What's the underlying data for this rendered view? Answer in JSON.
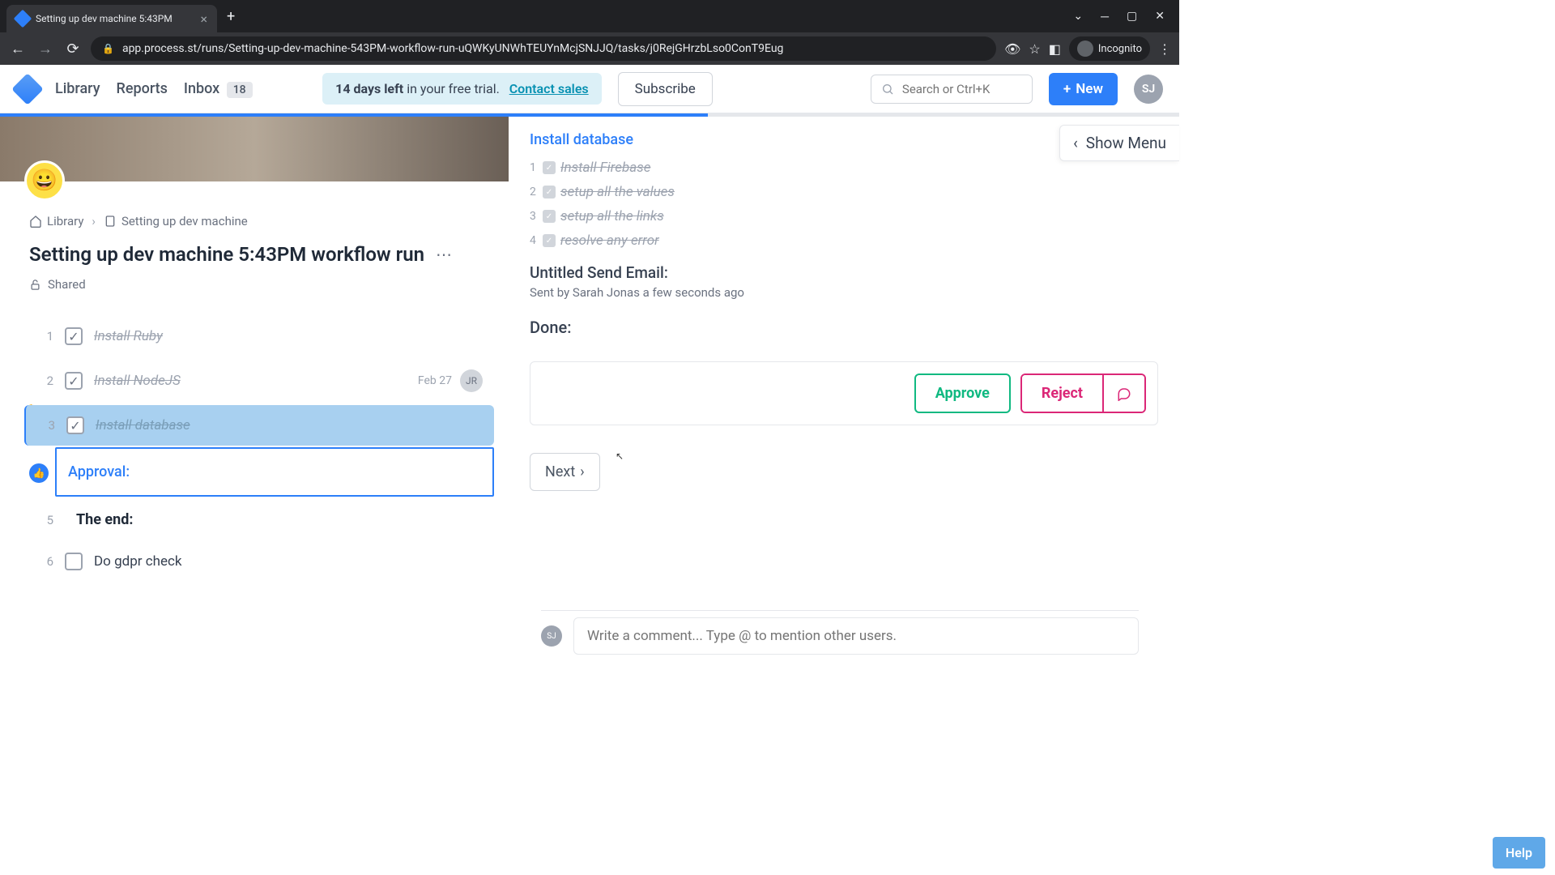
{
  "browser": {
    "tab_title": "Setting up dev machine 5:43PM",
    "url": "app.process.st/runs/Setting-up-dev-machine-543PM-workflow-run-uQWKyUNWhTEUYnMcjSNJJQ/tasks/j0RejGHrzbLso0ConT9Eug",
    "incognito_label": "Incognito"
  },
  "header": {
    "nav": {
      "library": "Library",
      "reports": "Reports",
      "inbox": "Inbox",
      "inbox_count": "18"
    },
    "trial": {
      "days": "14 days left",
      "rest": " in your free trial.",
      "contact": "Contact sales"
    },
    "subscribe": "Subscribe",
    "search_placeholder": "Search or Ctrl+K",
    "new_label": "New",
    "avatar": "SJ"
  },
  "breadcrumb": {
    "library": "Library",
    "workflow": "Setting up dev machine"
  },
  "page": {
    "title": "Setting up dev machine 5:43PM workflow run",
    "shared": "Shared"
  },
  "tasks": [
    {
      "num": "1",
      "label": "Install Ruby",
      "checked": true
    },
    {
      "num": "2",
      "label": "Install NodeJS",
      "checked": true,
      "date": "Feb 27",
      "assignee": "JR"
    },
    {
      "num": "3",
      "label": "Install database",
      "checked": true,
      "selected": true
    },
    {
      "type": "approval",
      "label": "Approval:"
    },
    {
      "num": "5",
      "type": "section",
      "label": "The end:"
    },
    {
      "num": "6",
      "label": "Do gdpr check",
      "checked": false
    }
  ],
  "detail": {
    "title": "Install database",
    "subtasks": [
      {
        "num": "1",
        "label": "Install Firebase"
      },
      {
        "num": "2",
        "label": "setup all the values"
      },
      {
        "num": "3",
        "label": "setup all the links"
      },
      {
        "num": "4",
        "label": "resolve any error"
      }
    ],
    "email_label": "Untitled Send Email:",
    "email_sub": "Sent by Sarah Jonas a few seconds ago",
    "done_label": "Done:",
    "approve": "Approve",
    "reject": "Reject",
    "next": "Next",
    "show_menu": "Show Menu"
  },
  "comment": {
    "avatar": "SJ",
    "placeholder": "Write a comment... Type @ to mention other users."
  },
  "help": "Help"
}
